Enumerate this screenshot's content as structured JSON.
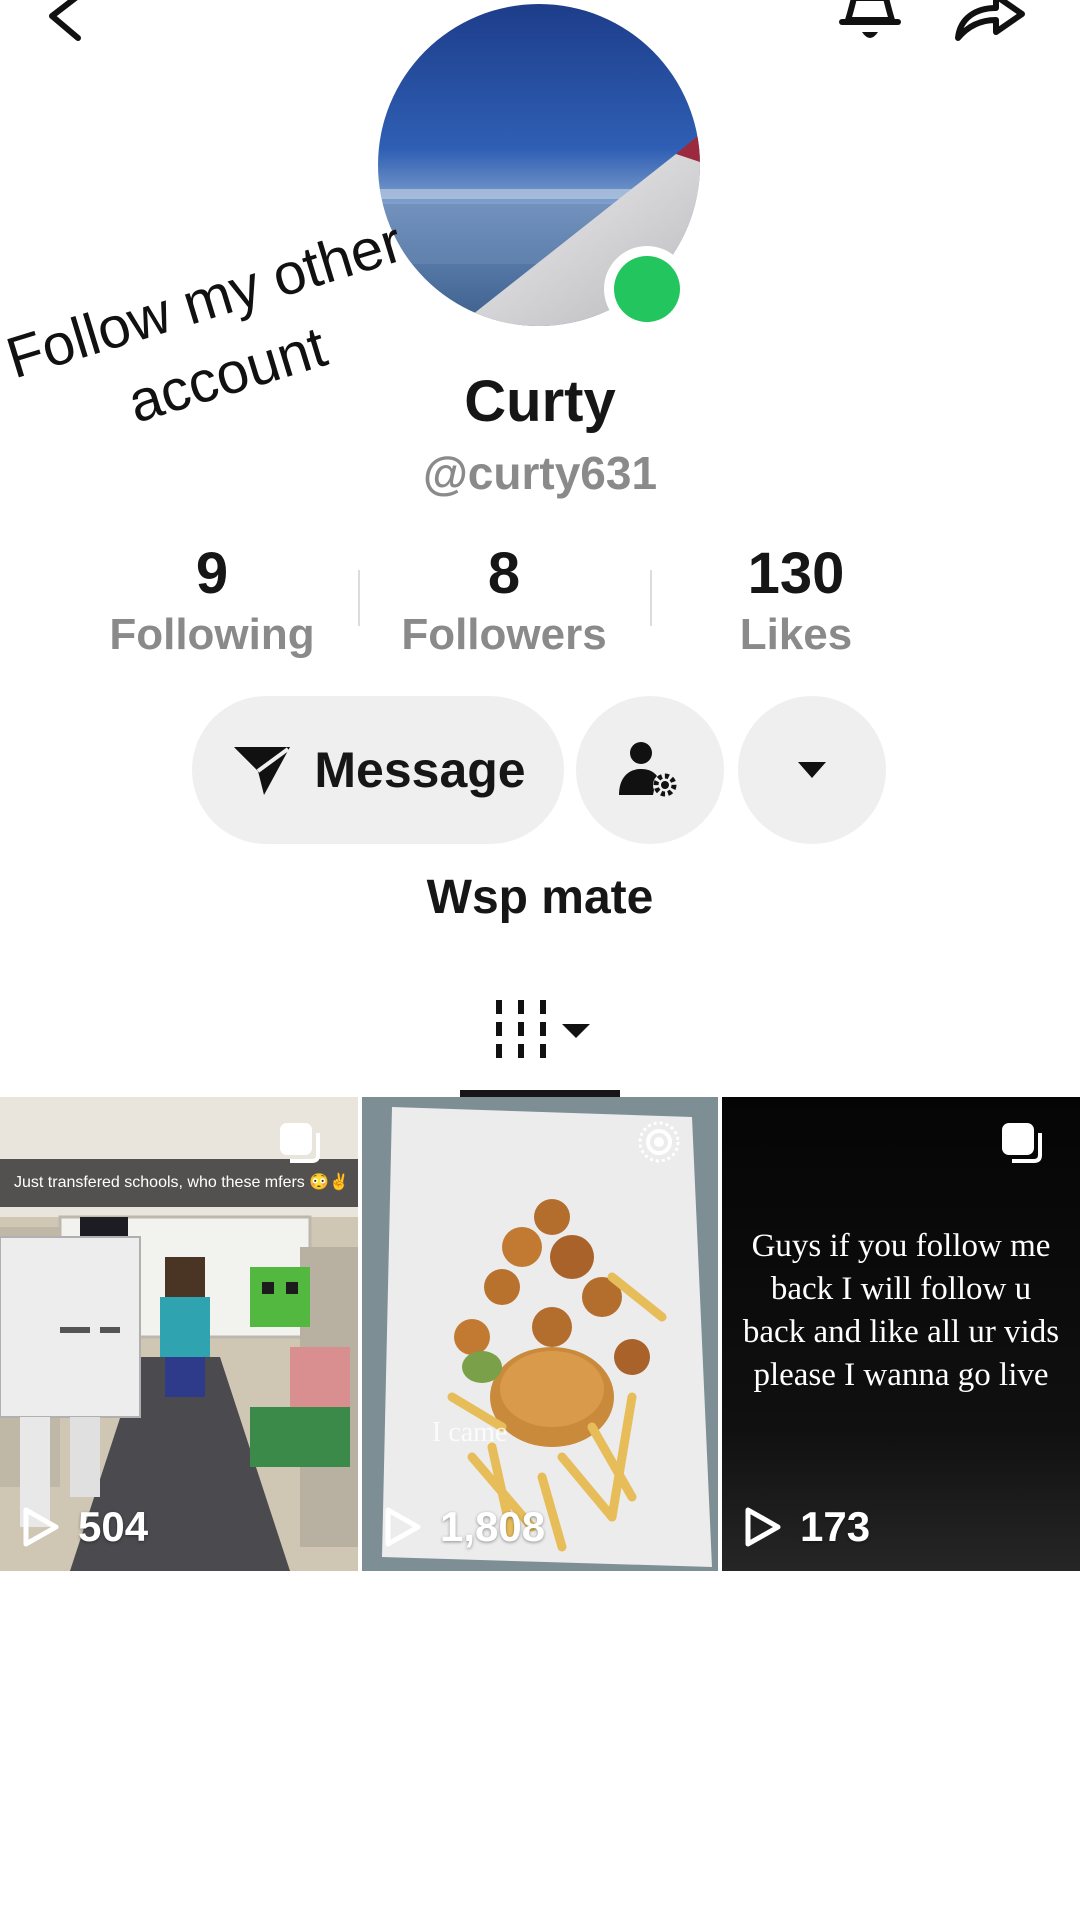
{
  "header": {
    "back_icon": "chevron-left-icon",
    "notification_icon": "bell-icon",
    "share_icon": "share-arrow-icon"
  },
  "profile": {
    "avatar_icon": "avatar-sky-wing-photo",
    "online_status_color": "#22c55e",
    "sticker_line_1": "Follow my other",
    "sticker_line_2": "account",
    "display_name": "Curty",
    "username": "@curty631",
    "bio": "Wsp mate"
  },
  "stats": [
    {
      "value": "9",
      "label": "Following"
    },
    {
      "value": "8",
      "label": "Followers"
    },
    {
      "value": "130",
      "label": "Likes"
    }
  ],
  "actions": {
    "message_label": "Message",
    "message_icon": "send-icon",
    "profile_settings_icon": "user-gear-icon",
    "more_icon": "caret-down-icon"
  },
  "tabs": {
    "videos_icon": "grid-lines-icon",
    "dropdown_icon": "caret-down-icon"
  },
  "videos": [
    {
      "caption": "Just transfered schools, who these mfers 😳✌",
      "overlay_text": "",
      "views": "504",
      "badge_icon": "carousel-icon"
    },
    {
      "caption": "",
      "overlay_text": "I came",
      "views": "1,808",
      "badge_icon": "target-icon"
    },
    {
      "caption": "",
      "overlay_text": "Guys if you follow me back I will follow u back and like all ur vids please I wanna go live",
      "views": "173",
      "badge_icon": "carousel-icon"
    }
  ],
  "colors": {
    "accent_text": "#161616",
    "muted_text": "#8a8a8a",
    "button_bg": "#efefef"
  }
}
